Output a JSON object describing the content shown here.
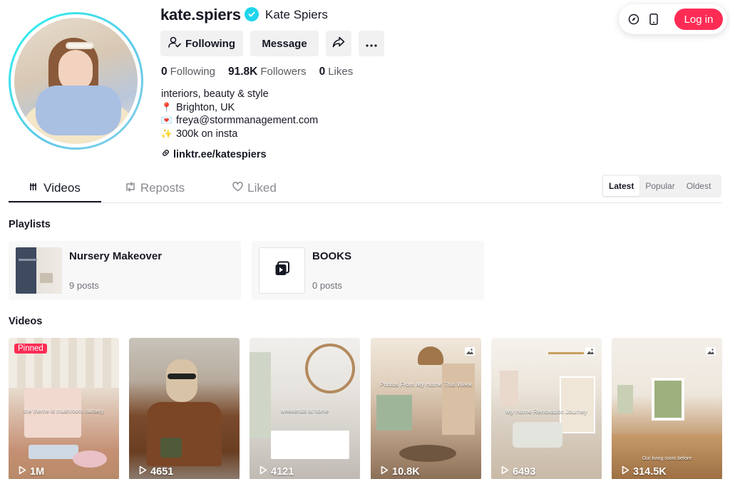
{
  "header": {
    "username": "kate.spiers",
    "nickname": "Kate Spiers",
    "verified_icon": "verified-check-icon"
  },
  "top_actions": {
    "compass_icon": "compass-icon",
    "phone_icon": "mobile-phone-icon",
    "login_label": "Log in",
    "login_color": "#fe2c55"
  },
  "buttons": {
    "following_label": "Following",
    "message_label": "Message",
    "share_icon": "share-icon",
    "more_icon": "more-dots-icon"
  },
  "stats": [
    {
      "value": "0",
      "label": "Following"
    },
    {
      "value": "91.8K",
      "label": "Followers"
    },
    {
      "value": "0",
      "label": "Likes"
    }
  ],
  "bio": {
    "line1": "interiors, beauty & style",
    "line2_emoji": "📍",
    "line2": "Brighton, UK",
    "line3_emoji": "💌",
    "line3": "freya@stormmanagement.com",
    "line4_emoji": "✨",
    "line4": "300k on insta",
    "link": "linktr.ee/katespiers"
  },
  "tabs": [
    {
      "label": "Videos",
      "icon": "grid-bars-icon",
      "active": true
    },
    {
      "label": "Reposts",
      "icon": "repost-icon",
      "active": false
    },
    {
      "label": "Liked",
      "icon": "heart-icon",
      "active": false
    }
  ],
  "sort": [
    "Latest",
    "Popular",
    "Oldest"
  ],
  "sections": {
    "playlists_title": "Playlists",
    "videos_title": "Videos"
  },
  "playlists": [
    {
      "title": "Nursery Makeover",
      "count": "9 posts"
    },
    {
      "title": "BOOKS",
      "count": "0 posts"
    }
  ],
  "videos": [
    {
      "views": "1M",
      "pinned": "Pinned",
      "overlay": "the theme is mushroom nursery"
    },
    {
      "views": "4651"
    },
    {
      "views": "4121",
      "overlay": "weekends at home"
    },
    {
      "views": "10.8K",
      "overlay": "Photos From My Home This Week"
    },
    {
      "views": "6493",
      "overlay": "My Home Renovation Journey"
    },
    {
      "views": "314.5K",
      "overlay": "Our living room before"
    }
  ],
  "colors": {
    "accent": "#fe2c55",
    "verified": "#20d5ec",
    "ring": "#25f4ee"
  }
}
